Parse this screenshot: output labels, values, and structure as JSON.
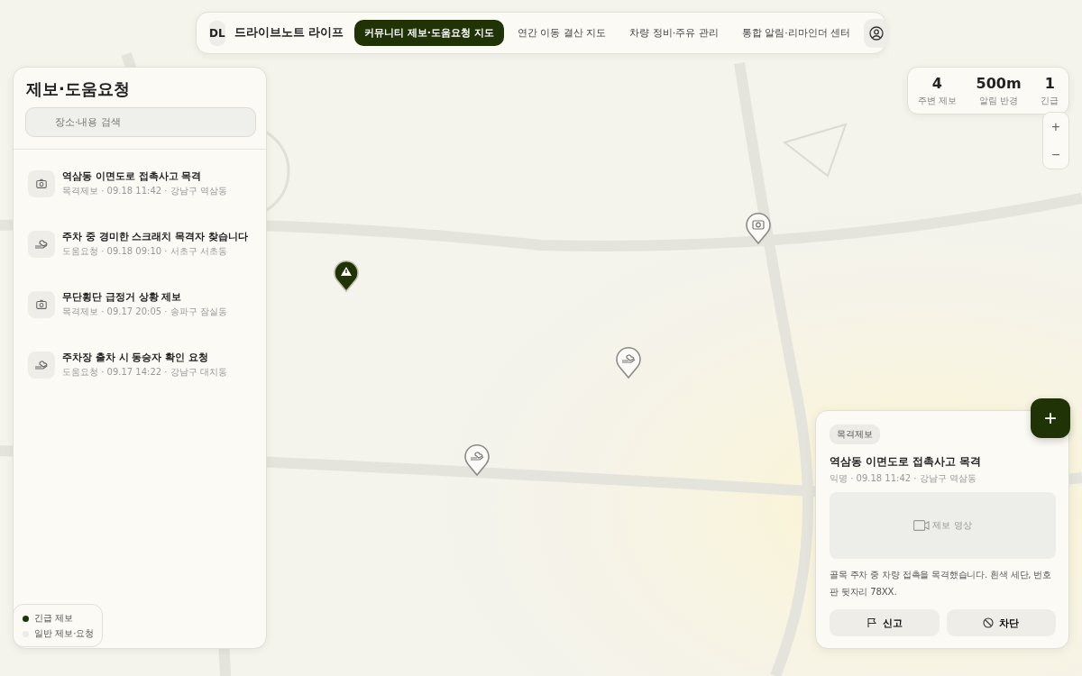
{
  "nav": {
    "logo": "DL",
    "brand": "드라이브노트 라이프",
    "tabs": [
      {
        "label": "커뮤니티 제보·도움요청 지도",
        "selected": true
      },
      {
        "label": "연간 이동 결산 지도",
        "selected": false
      },
      {
        "label": "차량 정비·주유 관리",
        "selected": false
      },
      {
        "label": "통합 알림·리마인더 센터",
        "selected": false
      }
    ]
  },
  "sidebar": {
    "title": "제보·도움요청",
    "search": {
      "placeholder": "장소·내용 검색"
    },
    "items": [
      {
        "kind": "witness",
        "title": "역삼동 이면도로 접촉사고 목격",
        "meta": "목격제보 · 09.18 11:42 · 강남구 역삼동"
      },
      {
        "kind": "help",
        "title": "주차 중 경미한 스크래치 목격자 찾습니다",
        "meta": "도움요청 · 09.18 09:10 · 서초구 서초동"
      },
      {
        "kind": "witness",
        "title": "무단횡단 급정거 상황 제보",
        "meta": "목격제보 · 09.17 20:05 · 송파구 잠실동"
      },
      {
        "kind": "help",
        "title": "주차장 출차 시 동승자 확인 요청",
        "meta": "도움요청 · 09.17 14:22 · 강남구 대치동"
      }
    ]
  },
  "legend": [
    {
      "label": "긴급 제보",
      "color": "#1f3306"
    },
    {
      "label": "일반 제보·요청",
      "color": "#ecece6"
    }
  ],
  "stats": [
    {
      "value": "4",
      "label": "주변 제보"
    },
    {
      "value": "500m",
      "label": "알림 반경"
    },
    {
      "value": "1",
      "label": "긴급"
    }
  ],
  "zoom": {
    "in": "+",
    "out": "−"
  },
  "pins": [
    {
      "kind": "urgent"
    },
    {
      "kind": "witness"
    },
    {
      "kind": "help"
    },
    {
      "kind": "help"
    }
  ],
  "detail": {
    "tag": "목격제보",
    "title": "역삼동 이면도로 접촉사고 목격",
    "meta": "익명 · 09.18 11:42 · 강남구 역삼동",
    "media": "제보 영상",
    "body": "골목 주차 중 차량 접촉을 목격했습니다. 흰색 세단, 번호판 뒷자리 78XX.",
    "actions": [
      {
        "kind": "report",
        "label": "신고"
      },
      {
        "kind": "block",
        "label": "차단"
      }
    ]
  },
  "fab": "+"
}
